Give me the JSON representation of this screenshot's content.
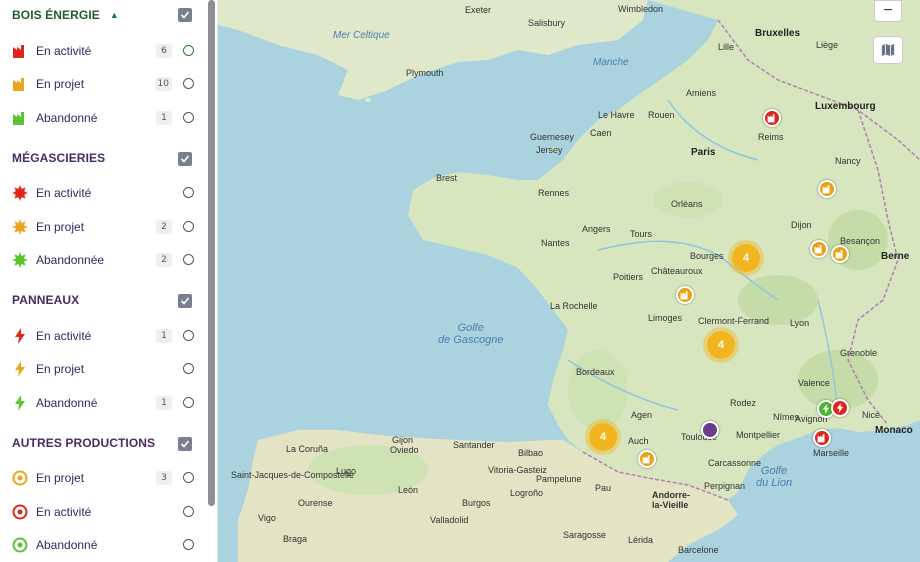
{
  "sidebar": {
    "groups": [
      {
        "title": "BOIS ÉNERGIE",
        "caret": "▲",
        "items": [
          {
            "label": "En activité",
            "count": "6"
          },
          {
            "label": "En projet",
            "count": "10"
          },
          {
            "label": "Abandonné",
            "count": "1"
          }
        ]
      },
      {
        "title": "MÉGASCIERIES",
        "items": [
          {
            "label": "En activité",
            "count": ""
          },
          {
            "label": "En projet",
            "count": "2"
          },
          {
            "label": "Abandonnée",
            "count": "2"
          }
        ]
      },
      {
        "title": "PANNEAUX",
        "items": [
          {
            "label": "En activité",
            "count": "1"
          },
          {
            "label": "En projet",
            "count": ""
          },
          {
            "label": "Abandonné",
            "count": "1"
          }
        ]
      },
      {
        "title": "AUTRES PRODUCTIONS",
        "items": [
          {
            "label": "En projet",
            "count": "3"
          },
          {
            "label": "En activité",
            "count": ""
          },
          {
            "label": "Abandonné",
            "count": ""
          }
        ]
      }
    ]
  },
  "map": {
    "clusters": [
      "4",
      "4",
      "4"
    ],
    "zoom_out": "−",
    "sea_labels": {
      "gascogne": "Golfe\nde Gascogne",
      "lion": "Golfe\ndu Lion",
      "celtique": "Mer Celtique",
      "manche": "Manche"
    },
    "cities": {
      "paris": "Paris",
      "bruxelles": "Bruxelles",
      "luxembourg": "Luxembourg",
      "berne": "Berne",
      "monaco": "Monaco",
      "lehavre": "Le Havre",
      "rouen": "Rouen",
      "caen": "Caen",
      "amiens": "Amiens",
      "reims": "Reims",
      "nancy": "Nancy",
      "brest": "Brest",
      "rennes": "Rennes",
      "nantes": "Nantes",
      "angers": "Angers",
      "tours": "Tours",
      "orleans": "Orléans",
      "dijon": "Dijon",
      "besancon": "Besançon",
      "lyon": "Lyon",
      "grenoble": "Grenoble",
      "limoges": "Limoges",
      "clermont": "Clermont-Ferrand",
      "bordeaux": "Bordeaux",
      "toulouse": "Toulouse",
      "montpellier": "Montpellier",
      "marseille": "Marseille",
      "nice": "Nice",
      "poitiers": "Poitiers",
      "larochelle": "La Rochelle",
      "pau": "Pau",
      "perpignan": "Perpignan",
      "andorre": "Andorre-\nla-Vieille",
      "bilbao": "Bilbao",
      "santander": "Santander",
      "oviedo": "Oviedo",
      "gijon": "Gijon",
      "leon": "León",
      "burgos": "Burgos",
      "pampelune": "Pampelune",
      "saragosse": "Saragosse",
      "lerida": "Lérida",
      "barcelone": "Barcelone",
      "logrono": "Logroño",
      "vitoria": "Vitoria-Gasteiz",
      "valladolid": "Valladolid",
      "braga": "Braga",
      "vigo": "Vigo",
      "lacoruna": "La Coruña",
      "santiago": "Saint-Jacques-de-Compostelle",
      "lugo": "Lugo",
      "ourense": "Ourense",
      "exeter": "Exeter",
      "plymouth": "Plymouth",
      "guernsey": "Guernesey",
      "jersey": "Jersey",
      "salisbury": "Salisbury",
      "londres": "Wimbledon",
      "lille": "Lille",
      "liege": "Liège",
      "chateauroux": "Châteauroux",
      "bourges": "Bourges",
      "valence": "Valence",
      "avignon": "Avignon",
      "nimes": "Nîmes",
      "carcassonne": "Carcassonne",
      "auch": "Auch",
      "agen": "Agen",
      "rodez": "Rodez"
    }
  }
}
